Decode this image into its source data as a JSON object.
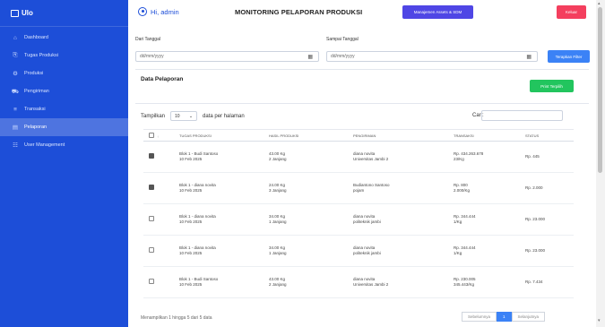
{
  "brand": {
    "name": "Ulo"
  },
  "sidebar": {
    "items": [
      {
        "label": "Dashboard",
        "icon": "⌂"
      },
      {
        "label": "Tugas Produksi",
        "icon": "⎘"
      },
      {
        "label": "Produksi",
        "icon": "⚙"
      },
      {
        "label": "Pengiriman",
        "icon": "⛟"
      },
      {
        "label": "Transaksi",
        "icon": "≡"
      },
      {
        "label": "Pelaporan",
        "icon": "▤"
      },
      {
        "label": "User Management",
        "icon": "☷"
      }
    ]
  },
  "header": {
    "greeting": "Hi, admin",
    "title": "MONITORING PELAPORAN PRODUKSI",
    "assets_button": "Manajemen Assets & SDM",
    "logout_button": "Keluar"
  },
  "filters": {
    "from_label": "Dari Tanggal",
    "from_placeholder": "dd/mm/yyyy",
    "to_label": "Sampai Tanggal",
    "to_placeholder": "dd/mm/yyyy",
    "apply_button": "Terapkan Filter"
  },
  "report": {
    "title": "Data Pelaporan",
    "print_button": "Print Terpilih",
    "show_label": "Tampilkan",
    "show_value": "10",
    "per_page_label": "data per halaman",
    "search_label": "Cari:"
  },
  "table": {
    "headers": [
      "TUGAS PRODUKSI",
      "HASIL PRODUKSI",
      "PENGIRIMAN",
      "TRANSAKSI",
      "STATUS"
    ],
    "rows": [
      {
        "checked": true,
        "task": "Blok 1 - Budi Santoso",
        "task_date": "10 Feb 2025",
        "result": "43.00 Kg",
        "result_sub": "2 Janjang",
        "ship": "diana novita",
        "ship_sub": "Universitas Jambi 2",
        "trx": "Rp. 434.263.678",
        "trx_sub": "23/Kg",
        "status": "Rp. 445"
      },
      {
        "checked": true,
        "task": "Blok 1 - diana novita",
        "task_date": "10 Feb 2025",
        "result": "24.00 Kg",
        "result_sub": "3 Janjang",
        "ship": "Budiantono Santoso",
        "ship_sub": "pojam",
        "trx": "Rp. 800",
        "trx_sub": "2.000/Kg",
        "status": "Rp. 2.000"
      },
      {
        "checked": false,
        "task": "Blok 1 - diana novita",
        "task_date": "10 Feb 2025",
        "result": "34.00 Kg",
        "result_sub": "1 Janjang",
        "ship": "diana novita",
        "ship_sub": "politeknik jambi",
        "trx": "Rp. 344.444",
        "trx_sub": "1/Kg",
        "status": "Rp. 23.000"
      },
      {
        "checked": false,
        "task": "Blok 1 - diana novita",
        "task_date": "10 Feb 2025",
        "result": "34.00 Kg",
        "result_sub": "1 Janjang",
        "ship": "diana novita",
        "ship_sub": "politeknik jambi",
        "trx": "Rp. 344.444",
        "trx_sub": "1/Kg",
        "status": "Rp. 23.000"
      },
      {
        "checked": false,
        "task": "Blok 1 - Budi Santoso",
        "task_date": "10 Feb 2025",
        "result": "43.00 Kg",
        "result_sub": "2 Janjang",
        "ship": "diana novita",
        "ship_sub": "Universitas Jambi 2",
        "trx": "Rp. 230.005",
        "trx_sub": "345.443/Kg",
        "status": "Rp. 7.434"
      }
    ]
  },
  "footer": {
    "info": "Menampilkan 1 hingga 5 dari 5 data",
    "prev": "Sebelumnya",
    "page": "1",
    "next": "Selanjutnya"
  }
}
